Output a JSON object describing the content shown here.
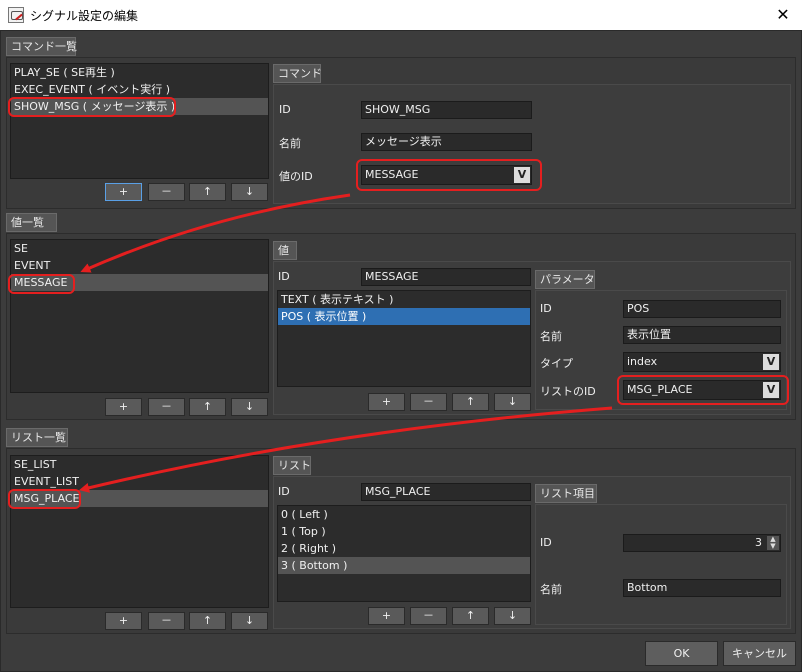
{
  "window": {
    "title": "シグナル設定の編集",
    "close": "✕"
  },
  "command_section": {
    "tab": "コマンド一覧",
    "items": [
      "PLAY_SE ( SE再生 )",
      "EXEC_EVENT ( イベント実行 )",
      "SHOW_MSG ( メッセージ表示 )"
    ],
    "detail": {
      "tab": "コマンド",
      "id_label": "ID",
      "id_value": "SHOW_MSG",
      "name_label": "名前",
      "name_value": "メッセージ表示",
      "value_id_label": "値のID",
      "value_id_value": "MESSAGE",
      "dropdown_glyph": "V"
    }
  },
  "value_section": {
    "tab": "値一覧",
    "items": [
      "SE",
      "EVENT",
      "MESSAGE"
    ],
    "detail": {
      "tab": "値",
      "id_label": "ID",
      "id_value": "MESSAGE",
      "params": [
        "TEXT ( 表示テキスト )",
        "POS ( 表示位置 )"
      ],
      "param_panel": {
        "tab": "パラメータ",
        "id_label": "ID",
        "id_value": "POS",
        "name_label": "名前",
        "name_value": "表示位置",
        "type_label": "タイプ",
        "type_value": "index",
        "list_id_label": "リストのID",
        "list_id_value": "MSG_PLACE",
        "dropdown_glyph": "V"
      }
    }
  },
  "list_section": {
    "tab": "リスト一覧",
    "items": [
      "SE_LIST",
      "EVENT_LIST",
      "MSG_PLACE"
    ],
    "detail": {
      "tab": "リスト",
      "id_label": "ID",
      "id_value": "MSG_PLACE",
      "entries": [
        "0 ( Left )",
        "1 ( Top )",
        "2 ( Right )",
        "3 ( Bottom )"
      ],
      "item_panel": {
        "tab": "リスト項目",
        "id_label": "ID",
        "id_value": "3",
        "name_label": "名前",
        "name_value": "Bottom",
        "spin_up": "▲",
        "spin_down": "▼"
      }
    }
  },
  "buttons": {
    "add": "+",
    "remove": "－",
    "up": "↑",
    "down": "↓"
  },
  "footer": {
    "ok": "OK",
    "cancel": "キャンセル"
  },
  "colors": {
    "annotation": "#e41f1f",
    "background": "#3c3c3c",
    "selection": "#2e6fb3"
  }
}
